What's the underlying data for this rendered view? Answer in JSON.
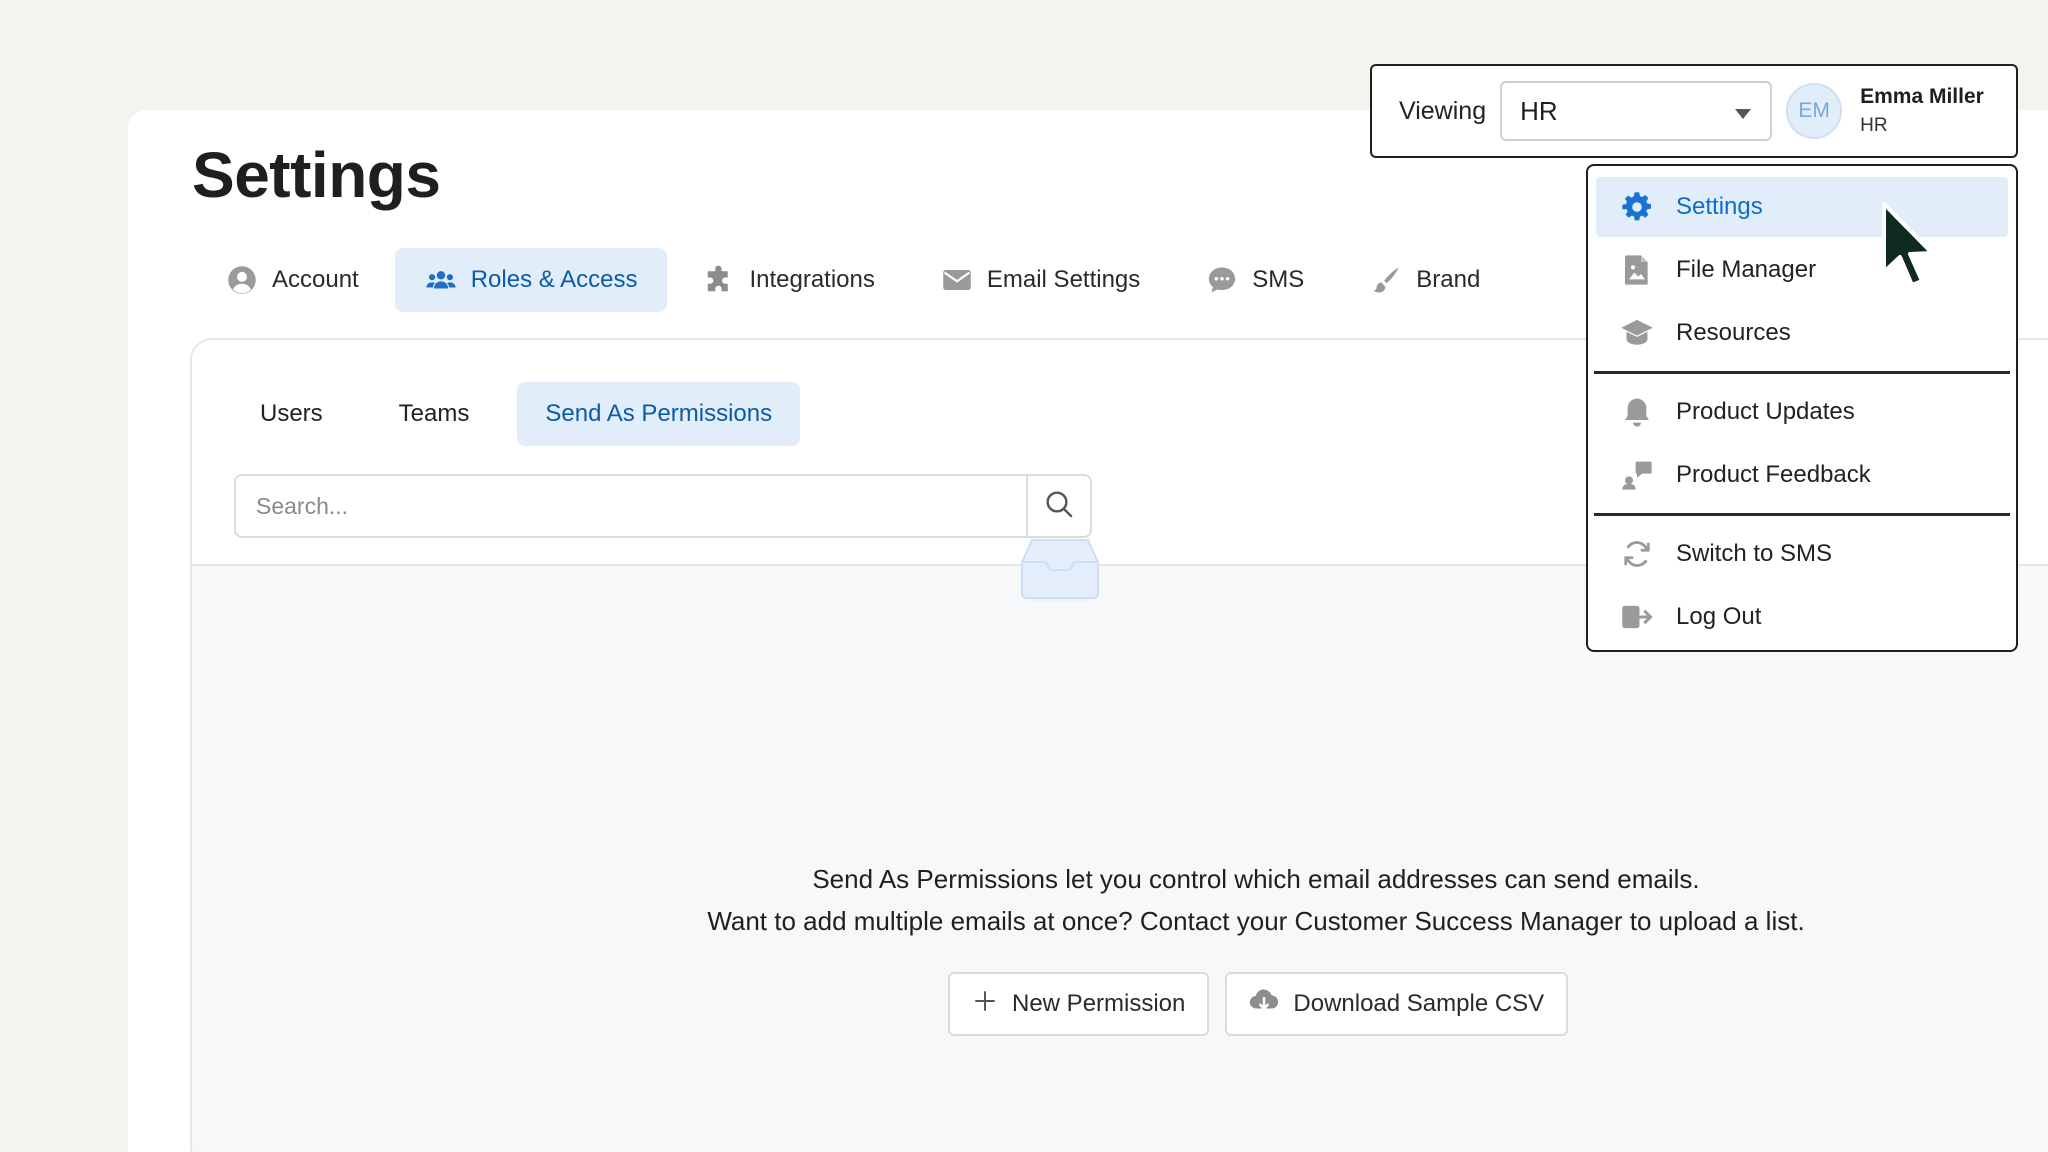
{
  "page": {
    "title": "Settings"
  },
  "main_tabs": [
    {
      "label": "Account",
      "icon": "user-circle-icon",
      "active": false
    },
    {
      "label": "Roles & Access",
      "icon": "users-icon",
      "active": true
    },
    {
      "label": "Integrations",
      "icon": "puzzle-icon",
      "active": false
    },
    {
      "label": "Email Settings",
      "icon": "envelope-icon",
      "active": false
    },
    {
      "label": "SMS",
      "icon": "chat-bubble-icon",
      "active": false
    },
    {
      "label": "Brand",
      "icon": "paintbrush-icon",
      "active": false
    }
  ],
  "sub_tabs": [
    {
      "label": "Users",
      "active": false
    },
    {
      "label": "Teams",
      "active": false
    },
    {
      "label": "Send As Permissions",
      "active": true
    }
  ],
  "search": {
    "placeholder": "Search...",
    "value": ""
  },
  "empty_state": {
    "icon": "inbox-tray-icon",
    "line1": "Send As Permissions let you control which email addresses can send emails.",
    "line2": "Want to add multiple emails at once? Contact your Customer Success Manager to upload a list."
  },
  "actions": {
    "new_permission": "New Permission",
    "download_csv": "Download Sample CSV"
  },
  "header": {
    "viewing_label": "Viewing",
    "viewing_value": "HR",
    "avatar_initials": "EM",
    "user_name": "Emma Miller",
    "user_role": "HR"
  },
  "user_menu": {
    "group1": [
      {
        "label": "Settings",
        "icon": "gear-icon",
        "active": true
      },
      {
        "label": "File Manager",
        "icon": "file-image-icon",
        "active": false
      },
      {
        "label": "Resources",
        "icon": "graduation-cap-icon",
        "active": false
      }
    ],
    "group2": [
      {
        "label": "Product Updates",
        "icon": "bell-icon",
        "active": false
      },
      {
        "label": "Product Feedback",
        "icon": "feedback-icon",
        "active": false
      }
    ],
    "group3": [
      {
        "label": "Switch to SMS",
        "icon": "sync-icon",
        "active": false
      },
      {
        "label": "Log Out",
        "icon": "logout-icon",
        "active": false
      }
    ]
  },
  "colors": {
    "accent": "#0d6cc7",
    "active_bg": "#e1edf9",
    "icon_gray": "#9a9a9a"
  }
}
